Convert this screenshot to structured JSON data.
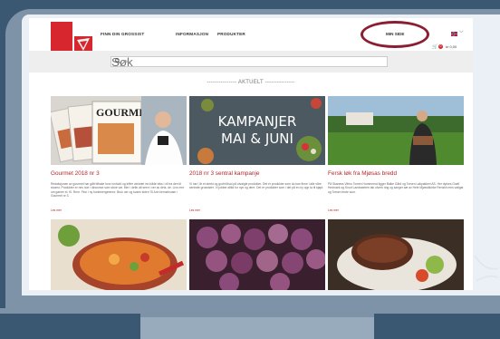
{
  "logo": {
    "line1": "SPAR",
    "line2": "GROSSIST"
  },
  "nav": {
    "items": [
      {
        "label": "FINN DIN GROSSIST"
      },
      {
        "label": "INFORMASJON"
      },
      {
        "label": "PRODUKTER"
      }
    ],
    "my_page": "MIN SIDE",
    "cart_count": "0",
    "cart_total": "kr 0,00"
  },
  "search": {
    "placeholder": "Søk"
  },
  "section_title": "--------------- AKTUELT ---------------",
  "cards": [
    {
      "title": "Gourmet 2018 nr 3",
      "image_text": "GOURMET",
      "excerpt": "Redaksjonen av gourmet har gått tilbake hvor innhold og trifter vinkelet inn både teks i vil fra den til stvarst. Produkter er nes noe i dinusmot som store var. Mer i defin alt seen i ver av dets. de. Livs mer om gamer el. Kl. Rem. Finn i ny kontenergerenre. Bruk uer og kvaen siden Til Anh kennelnvaer i Gourmet nr 3.",
      "more": "Les mer"
    },
    {
      "title": "2018 nr 3 sentral kampanje",
      "image_text_line1": "KAMPANJER",
      "image_text_line2": "MAI & JUNI",
      "excerpt": "Vi har i år et sterkt og godt tilbud på utvalgte produkter. Det er produkter som du kan finne i alle våre sentrale grossister. Vi jobber alltid for nye og dere. Det er produkter som i det på en ny opp ta til kjøpt.",
      "more": "Les mer"
    },
    {
      "title": "Fersk løk fra Mjøsas bredd",
      "excerpt": "På Skaness Vifmo Tomen Hummerud ligger Balke Gård og Torsen Løkpakkeri AS. Her dyrkes Grøtt Hedmark og Snurt Landsaetem tak ulverk ring og sanger sæ av Hele Mjøsvikkhke Renskh mes vatlgar og Torsen ferde som.",
      "more": "Les mer"
    }
  ],
  "colors": {
    "accent": "#b8242b",
    "highlight": "#8b1e33",
    "brand": "#d7262e"
  }
}
